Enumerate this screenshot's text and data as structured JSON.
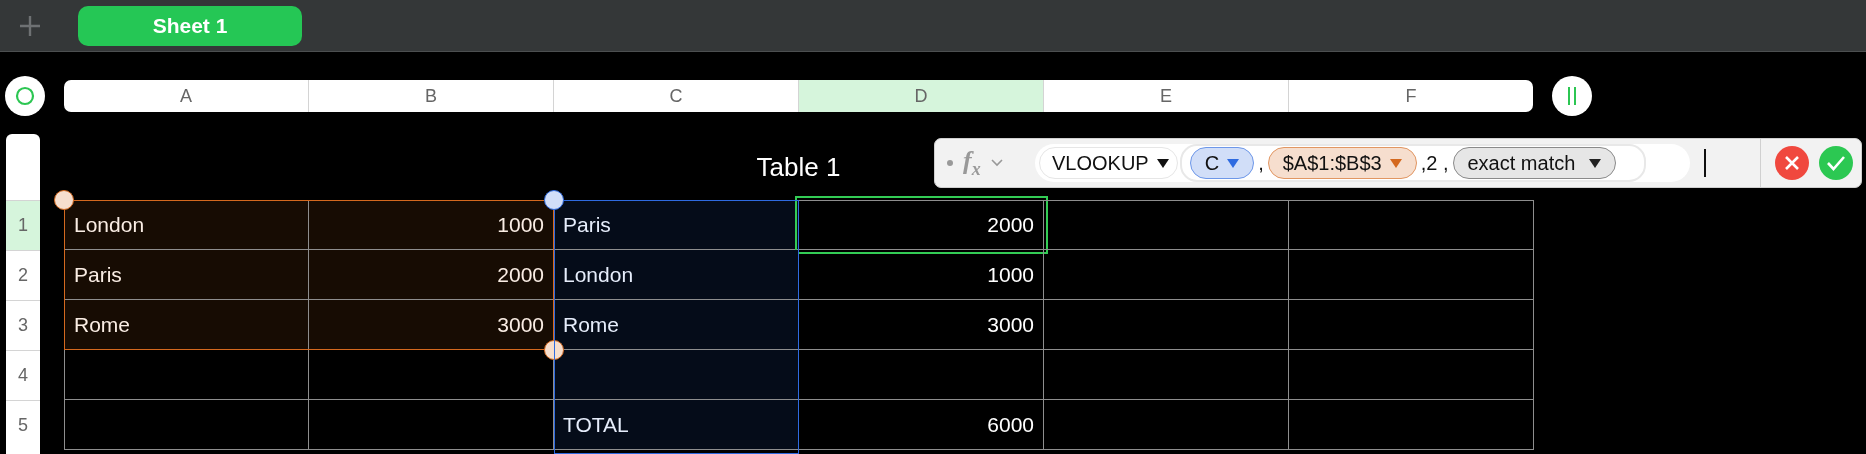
{
  "tabs": [
    {
      "label": "Sheet 1",
      "selected": true
    }
  ],
  "columns": [
    {
      "label": "A",
      "selected": false
    },
    {
      "label": "B",
      "selected": false
    },
    {
      "label": "C",
      "selected": false
    },
    {
      "label": "D",
      "selected": true
    },
    {
      "label": "E",
      "selected": false
    },
    {
      "label": "F",
      "selected": false
    }
  ],
  "table": {
    "title": "Table 1",
    "rows": [
      {
        "label": "1",
        "selected": true,
        "cells": [
          {
            "text": "London",
            "color": "#d4691f"
          },
          {
            "text": "1000",
            "color": "#d4691f"
          },
          {
            "text": "Paris",
            "color": "#2f6be0"
          },
          {
            "text": "2000",
            "selected": true
          },
          {
            "text": ""
          },
          {
            "text": ""
          }
        ]
      },
      {
        "label": "2",
        "selected": false,
        "cells": [
          {
            "text": "Paris",
            "color": "#d4691f"
          },
          {
            "text": "2000",
            "color": "#d4691f"
          },
          {
            "text": "London",
            "color": "#2f6be0"
          },
          {
            "text": "1000"
          },
          {
            "text": ""
          },
          {
            "text": ""
          }
        ]
      },
      {
        "label": "3",
        "selected": false,
        "cells": [
          {
            "text": "Rome",
            "color": "#d4691f"
          },
          {
            "text": "3000",
            "color": "#d4691f"
          },
          {
            "text": "Rome",
            "color": "#2f6be0"
          },
          {
            "text": "3000"
          },
          {
            "text": ""
          },
          {
            "text": ""
          }
        ]
      },
      {
        "label": "4",
        "selected": false,
        "cells": [
          {
            "text": ""
          },
          {
            "text": ""
          },
          {
            "text": "",
            "color": "#2f6be0"
          },
          {
            "text": ""
          },
          {
            "text": ""
          },
          {
            "text": ""
          }
        ]
      },
      {
        "label": "5",
        "selected": false,
        "cells": [
          {
            "text": ""
          },
          {
            "text": ""
          },
          {
            "text": "TOTAL",
            "color": "#2f6be0"
          },
          {
            "text": "6000"
          },
          {
            "text": ""
          },
          {
            "text": ""
          }
        ]
      }
    ]
  },
  "formula_editor": {
    "function_button": "f$_{x}$",
    "tokens": [
      {
        "kind": "function",
        "text": "VLOOKUP"
      },
      {
        "kind": "ref",
        "text": "C",
        "color": "#2f6be0"
      },
      {
        "kind": "text",
        "text": ","
      },
      {
        "kind": "ref",
        "text": "$A$1:$B$3",
        "color": "#d4691f"
      },
      {
        "kind": "text",
        "text": ",2 ,"
      },
      {
        "kind": "option",
        "text": "exact match"
      }
    ]
  }
}
